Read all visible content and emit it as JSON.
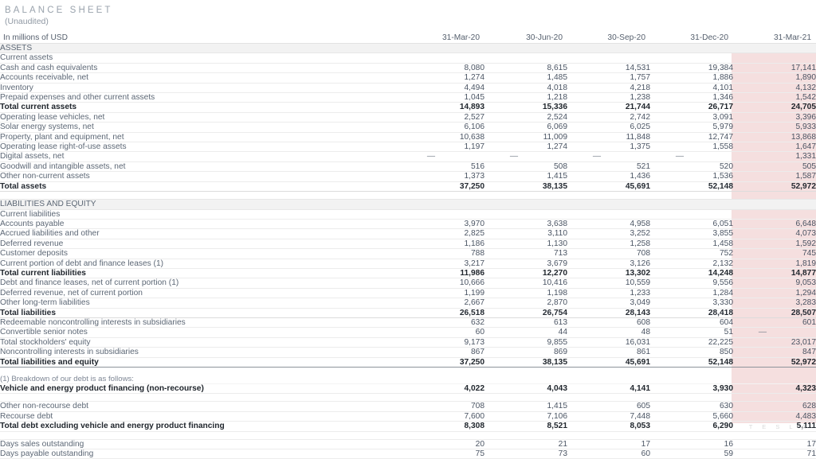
{
  "document": {
    "title": "BALANCE SHEET",
    "subtitle": "(Unaudited)",
    "units_label": "In millions of USD",
    "watermark": "T E S L A",
    "highlight_color": "#f5dfdf",
    "section_band_color": "#f2f2f2"
  },
  "columns": [
    "31-Mar-20",
    "30-Jun-20",
    "30-Sep-20",
    "31-Dec-20",
    "31-Mar-21"
  ],
  "sections": {
    "assets_header": "ASSETS",
    "current_assets_header": "Current assets",
    "liabilities_header": "LIABILITIES AND EQUITY",
    "current_liabilities_header": "Current liabilities",
    "footnote_intro": "(1) Breakdown of our debt is as follows:"
  },
  "rows": [
    {
      "label": "Cash and cash equivalents",
      "indent": 1,
      "values": [
        "8,080",
        "8,615",
        "14,531",
        "19,384",
        "17,141"
      ]
    },
    {
      "label": "Accounts receivable, net",
      "indent": 1,
      "values": [
        "1,274",
        "1,485",
        "1,757",
        "1,886",
        "1,890"
      ]
    },
    {
      "label": "Inventory",
      "indent": 1,
      "values": [
        "4,494",
        "4,018",
        "4,218",
        "4,101",
        "4,132"
      ]
    },
    {
      "label": "Prepaid expenses and other current assets",
      "indent": 1,
      "values": [
        "1,045",
        "1,218",
        "1,238",
        "1,346",
        "1,542"
      ]
    },
    {
      "label": "Total current assets",
      "indent": 2,
      "values": [
        "14,893",
        "15,336",
        "21,744",
        "26,717",
        "24,705"
      ]
    },
    {
      "label": "Operating lease vehicles, net",
      "indent": 0,
      "values": [
        "2,527",
        "2,524",
        "2,742",
        "3,091",
        "3,396"
      ]
    },
    {
      "label": "Solar energy systems, net",
      "indent": 0,
      "values": [
        "6,106",
        "6,069",
        "6,025",
        "5,979",
        "5,933"
      ]
    },
    {
      "label": "Property, plant and equipment, net",
      "indent": 0,
      "values": [
        "10,638",
        "11,009",
        "11,848",
        "12,747",
        "13,868"
      ]
    },
    {
      "label": "Operating lease right-of-use assets",
      "indent": 0,
      "values": [
        "1,197",
        "1,274",
        "1,375",
        "1,558",
        "1,647"
      ]
    },
    {
      "label": "Digital assets, net",
      "indent": 0,
      "values": [
        "—",
        "—",
        "—",
        "—",
        "1,331"
      ]
    },
    {
      "label": "Goodwill and intangible assets, net",
      "indent": 0,
      "values": [
        "516",
        "508",
        "521",
        "520",
        "505"
      ]
    },
    {
      "label": "Other non-current assets",
      "indent": 0,
      "values": [
        "1,373",
        "1,415",
        "1,436",
        "1,536",
        "1,587"
      ]
    },
    {
      "label": "Total assets",
      "indent": 2,
      "values": [
        "37,250",
        "38,135",
        "45,691",
        "52,148",
        "52,972"
      ]
    },
    {
      "label": "Accounts payable",
      "indent": 1,
      "values": [
        "3,970",
        "3,638",
        "4,958",
        "6,051",
        "6,648"
      ]
    },
    {
      "label": "Accrued liabilities and other",
      "indent": 1,
      "values": [
        "2,825",
        "3,110",
        "3,252",
        "3,855",
        "4,073"
      ]
    },
    {
      "label": "Deferred revenue",
      "indent": 1,
      "values": [
        "1,186",
        "1,130",
        "1,258",
        "1,458",
        "1,592"
      ]
    },
    {
      "label": "Customer deposits",
      "indent": 1,
      "values": [
        "788",
        "713",
        "708",
        "752",
        "745"
      ]
    },
    {
      "label": "Current portion of debt and finance leases (1)",
      "indent": 1,
      "values": [
        "3,217",
        "3,679",
        "3,126",
        "2,132",
        "1,819"
      ]
    },
    {
      "label": "Total current liabilities",
      "indent": 2,
      "values": [
        "11,986",
        "12,270",
        "13,302",
        "14,248",
        "14,877"
      ]
    },
    {
      "label": "Debt and finance leases, net of current portion (1)",
      "indent": 0,
      "values": [
        "10,666",
        "10,416",
        "10,559",
        "9,556",
        "9,053"
      ]
    },
    {
      "label": "Deferred revenue, net of current portion",
      "indent": 0,
      "values": [
        "1,199",
        "1,198",
        "1,233",
        "1,284",
        "1,294"
      ]
    },
    {
      "label": "Other long-term liabilities",
      "indent": 0,
      "values": [
        "2,667",
        "2,870",
        "3,049",
        "3,330",
        "3,283"
      ]
    },
    {
      "label": "Total liabilities",
      "indent": 2,
      "values": [
        "26,518",
        "26,754",
        "28,143",
        "28,418",
        "28,507"
      ]
    },
    {
      "label": "Redeemable noncontrolling interests in subsidiaries",
      "indent": 0,
      "values": [
        "632",
        "613",
        "608",
        "604",
        "601"
      ]
    },
    {
      "label": "Convertible senior notes",
      "indent": 0,
      "values": [
        "60",
        "44",
        "48",
        "51",
        "—"
      ]
    },
    {
      "label": "Total stockholders' equity",
      "indent": 0,
      "values": [
        "9,173",
        "9,855",
        "16,031",
        "22,225",
        "23,017"
      ]
    },
    {
      "label": "Noncontrolling interests in subsidiaries",
      "indent": 0,
      "values": [
        "867",
        "869",
        "861",
        "850",
        "847"
      ]
    },
    {
      "label": "Total liabilities and equity",
      "indent": 2,
      "values": [
        "37,250",
        "38,135",
        "45,691",
        "52,148",
        "52,972"
      ]
    },
    {
      "label": "Vehicle and energy product financing (non-recourse)",
      "indent": 1,
      "values": [
        "4,022",
        "4,043",
        "4,141",
        "3,930",
        "4,323"
      ]
    },
    {
      "label": "Other non-recourse debt",
      "indent": 1,
      "values": [
        "708",
        "1,415",
        "605",
        "630",
        "628"
      ]
    },
    {
      "label": "Recourse debt",
      "indent": 1,
      "values": [
        "7,600",
        "7,106",
        "7,448",
        "5,660",
        "4,483"
      ]
    },
    {
      "label": "Total debt excluding vehicle and energy product financing",
      "indent": 2,
      "values": [
        "8,308",
        "8,521",
        "8,053",
        "6,290",
        "5,111"
      ]
    },
    {
      "label": "Days sales outstanding",
      "indent": 1,
      "values": [
        "20",
        "21",
        "17",
        "16",
        "17"
      ]
    },
    {
      "label": "Days payable outstanding",
      "indent": 1,
      "values": [
        "75",
        "73",
        "60",
        "59",
        "71"
      ]
    }
  ]
}
